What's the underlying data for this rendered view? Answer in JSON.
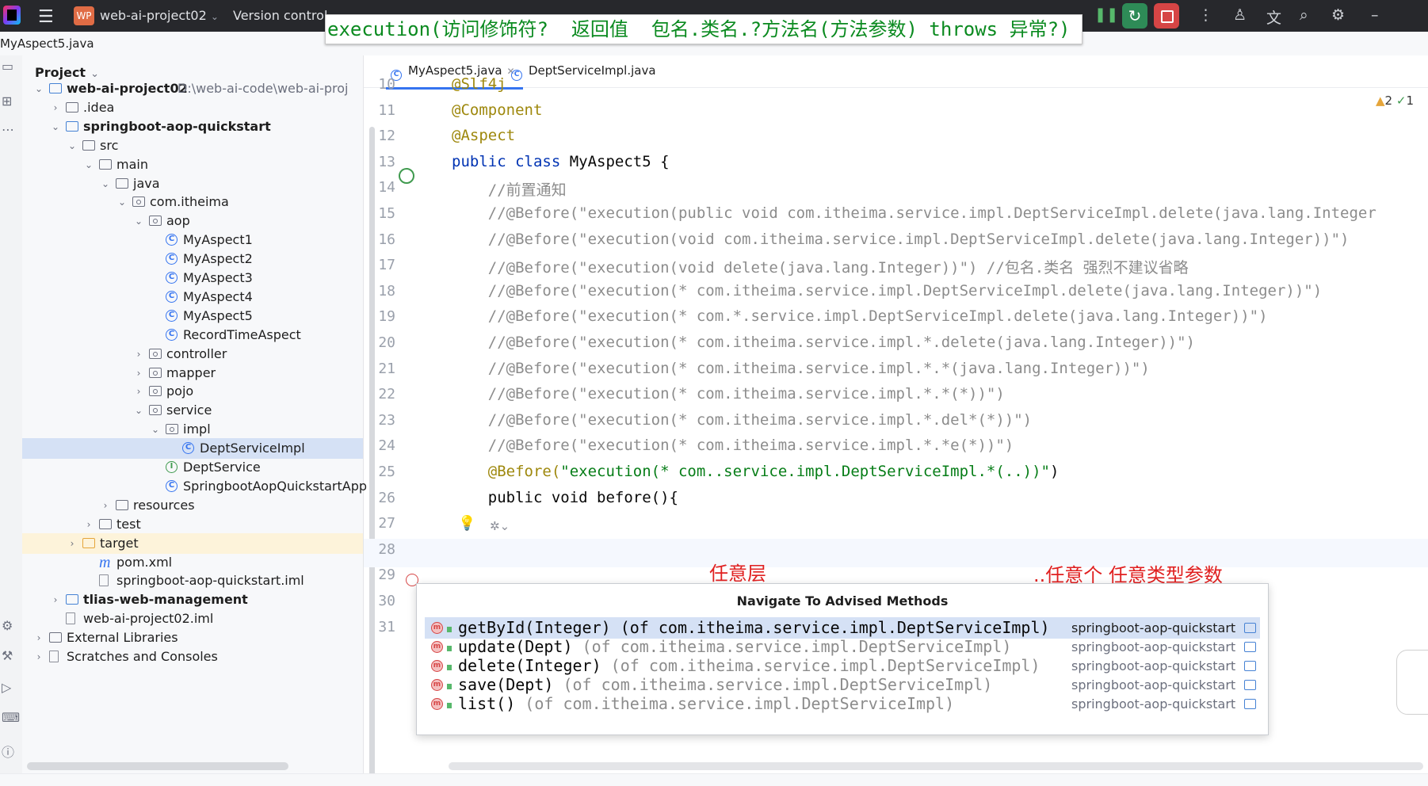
{
  "titlebar": {
    "project_badge": "WP",
    "project_name": "web-ai-project02",
    "version_control": "Version control",
    "icons": [
      "hamburger-menu-icon",
      "pause-icon",
      "rerun-icon",
      "stop-icon",
      "more-icon",
      "add-user-icon",
      "translate-icon",
      "search-icon",
      "settings-icon",
      "minimize-icon"
    ]
  },
  "annotation": "execution(访问修饰符?  返回值  包名.类名.?方法名(方法参数) throws 异常?)",
  "filebar": {
    "file": "MyAspect5.java"
  },
  "project": {
    "title": "Project",
    "root_path": "D:\\web-ai-code\\web-ai-proj",
    "tree": [
      {
        "label": "web-ai-project02",
        "depth": 0,
        "icon": "module",
        "expanded": true,
        "bold": true
      },
      {
        "label": ".idea",
        "depth": 1,
        "icon": "folder",
        "expanded": false
      },
      {
        "label": "springboot-aop-quickstart",
        "depth": 1,
        "icon": "module",
        "expanded": true,
        "bold": true
      },
      {
        "label": "src",
        "depth": 2,
        "icon": "folder",
        "expanded": true
      },
      {
        "label": "main",
        "depth": 3,
        "icon": "folder",
        "expanded": true
      },
      {
        "label": "java",
        "depth": 4,
        "icon": "folder",
        "expanded": true
      },
      {
        "label": "com.itheima",
        "depth": 5,
        "icon": "package",
        "expanded": true
      },
      {
        "label": "aop",
        "depth": 6,
        "icon": "package",
        "expanded": true
      },
      {
        "label": "MyAspect1",
        "depth": 7,
        "icon": "class"
      },
      {
        "label": "MyAspect2",
        "depth": 7,
        "icon": "class"
      },
      {
        "label": "MyAspect3",
        "depth": 7,
        "icon": "class"
      },
      {
        "label": "MyAspect4",
        "depth": 7,
        "icon": "class"
      },
      {
        "label": "MyAspect5",
        "depth": 7,
        "icon": "class"
      },
      {
        "label": "RecordTimeAspect",
        "depth": 7,
        "icon": "class"
      },
      {
        "label": "controller",
        "depth": 6,
        "icon": "package",
        "expanded": false
      },
      {
        "label": "mapper",
        "depth": 6,
        "icon": "package",
        "expanded": false
      },
      {
        "label": "pojo",
        "depth": 6,
        "icon": "package",
        "expanded": false
      },
      {
        "label": "service",
        "depth": 6,
        "icon": "package",
        "expanded": true
      },
      {
        "label": "impl",
        "depth": 7,
        "icon": "package",
        "expanded": true
      },
      {
        "label": "DeptServiceImpl",
        "depth": 8,
        "icon": "class",
        "selected": true
      },
      {
        "label": "DeptService",
        "depth": 7,
        "icon": "interface"
      },
      {
        "label": "SpringbootAopQuickstartApp",
        "depth": 7,
        "icon": "class"
      },
      {
        "label": "resources",
        "depth": 4,
        "icon": "folder",
        "expanded": false
      },
      {
        "label": "test",
        "depth": 3,
        "icon": "folder",
        "expanded": false
      },
      {
        "label": "target",
        "depth": 2,
        "icon": "target",
        "expanded": false,
        "highlight": true
      },
      {
        "label": "pom.xml",
        "depth": 3,
        "icon": "maven"
      },
      {
        "label": "springboot-aop-quickstart.iml",
        "depth": 3,
        "icon": "file"
      },
      {
        "label": "tlias-web-management",
        "depth": 1,
        "icon": "module",
        "expanded": false,
        "bold": true
      },
      {
        "label": "web-ai-project02.iml",
        "depth": 1,
        "icon": "file"
      },
      {
        "label": "External Libraries",
        "depth": 0,
        "icon": "library",
        "expanded": false
      },
      {
        "label": "Scratches and Consoles",
        "depth": 0,
        "icon": "scratch",
        "expanded": false
      }
    ]
  },
  "tabs": [
    {
      "label": "MyAspect5.java",
      "active": true
    },
    {
      "label": "DeptServiceImpl.java",
      "active": false
    }
  ],
  "inspections": {
    "warnings": "2",
    "ok": "1"
  },
  "editor": {
    "lines": [
      {
        "n": "10",
        "t": "@Slf4j"
      },
      {
        "n": "11",
        "t": "@Component"
      },
      {
        "n": "12",
        "t": "@Aspect"
      },
      {
        "n": "13",
        "t": "public class MyAspect5 {"
      },
      {
        "n": "14",
        "t": "    //前置通知"
      },
      {
        "n": "15",
        "t": "    //@Before(\"execution(public void com.itheima.service.impl.DeptServiceImpl.delete(java.lang.Integer"
      },
      {
        "n": "16",
        "t": "    //@Before(\"execution(void com.itheima.service.impl.DeptServiceImpl.delete(java.lang.Integer))\")"
      },
      {
        "n": "17",
        "t": "    //@Before(\"execution(void delete(java.lang.Integer))\") //包名.类名 强烈不建议省略"
      },
      {
        "n": "18",
        "t": "    //@Before(\"execution(* com.itheima.service.impl.DeptServiceImpl.delete(java.lang.Integer))\")"
      },
      {
        "n": "19",
        "t": "    //@Before(\"execution(* com.*.service.impl.DeptServiceImpl.delete(java.lang.Integer))\")"
      },
      {
        "n": "20",
        "t": "    //@Before(\"execution(* com.itheima.service.impl.*.delete(java.lang.Integer))\")"
      },
      {
        "n": "21",
        "t": "    //@Before(\"execution(* com.itheima.service.impl.*.*(java.lang.Integer))\")"
      },
      {
        "n": "22",
        "t": "    //@Before(\"execution(* com.itheima.service.impl.*.*(*))\")"
      },
      {
        "n": "23",
        "t": "    //@Before(\"execution(* com.itheima.service.impl.*.del*(*))\")"
      },
      {
        "n": "24",
        "t": "    //@Before(\"execution(* com.itheima.service.impl.*.*e(*))\")"
      },
      {
        "n": "25",
        "t_ann": "    @Before(",
        "t_str": "\"execution(* com..service.impl.DeptServiceImpl.*(..))\"",
        "t_end": ")"
      },
      {
        "n": "26",
        "t": "    public void before(){"
      },
      {
        "n": "27",
        "t": ""
      },
      {
        "n": "28",
        "t": ""
      },
      {
        "n": "29",
        "t": ""
      },
      {
        "n": "30",
        "t": ""
      },
      {
        "n": "31",
        "t": ""
      }
    ],
    "red_notes": {
      "left": "任意层",
      "right": "..任意个 任意类型参数"
    }
  },
  "popup": {
    "title": "Navigate To Advised Methods",
    "items": [
      {
        "method": "getById(Integer)",
        "of": "(of com.itheima.service.impl.DeptServiceImpl)",
        "module": "springboot-aop-quickstart",
        "selected": true
      },
      {
        "method": "update(Dept)",
        "of": "(of com.itheima.service.impl.DeptServiceImpl)",
        "module": "springboot-aop-quickstart"
      },
      {
        "method": "delete(Integer)",
        "of": "(of com.itheima.service.impl.DeptServiceImpl)",
        "module": "springboot-aop-quickstart"
      },
      {
        "method": "save(Dept)",
        "of": "(of com.itheima.service.impl.DeptServiceImpl)",
        "module": "springboot-aop-quickstart"
      },
      {
        "method": "list()",
        "of": "(of com.itheima.service.impl.DeptServiceImpl)",
        "module": "springboot-aop-quickstart"
      }
    ]
  },
  "colors": {
    "accent": "#3574f0",
    "selection": "#d5e1f5",
    "annotation_text": "#0a8a1f",
    "note_red": "#e02020"
  }
}
